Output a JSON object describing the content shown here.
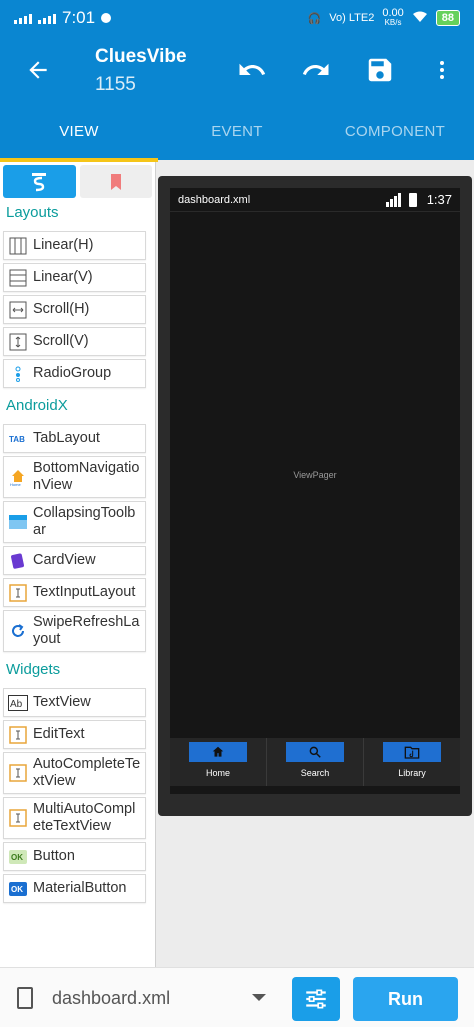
{
  "status_bar": {
    "time": "7:01",
    "network_label": "Vo) LTE2",
    "speed_value": "0.00",
    "speed_unit": "KB/s",
    "battery": "88"
  },
  "app_bar": {
    "title": "CluesVibe",
    "subtitle": "1155"
  },
  "tabs": [
    {
      "label": "VIEW",
      "active": true
    },
    {
      "label": "EVENT",
      "active": false
    },
    {
      "label": "COMPONENT",
      "active": false
    }
  ],
  "palette": {
    "sections": [
      {
        "title": "Layouts",
        "items": [
          {
            "label": "Linear(H)",
            "icon": "linear-horizontal-icon"
          },
          {
            "label": "Linear(V)",
            "icon": "linear-vertical-icon"
          },
          {
            "label": "Scroll(H)",
            "icon": "scroll-horizontal-icon"
          },
          {
            "label": "Scroll(V)",
            "icon": "scroll-vertical-icon"
          },
          {
            "label": "RadioGroup",
            "icon": "radiogroup-icon"
          }
        ]
      },
      {
        "title": "AndroidX",
        "items": [
          {
            "label": "TabLayout",
            "icon": "tablayout-icon"
          },
          {
            "label": "BottomNavigationView",
            "icon": "bottomnav-icon"
          },
          {
            "label": "CollapsingToolbar",
            "icon": "collapsing-toolbar-icon"
          },
          {
            "label": "CardView",
            "icon": "cardview-icon"
          },
          {
            "label": "TextInputLayout",
            "icon": "textinput-icon"
          },
          {
            "label": "SwipeRefreshLayout",
            "icon": "swiperefresh-icon"
          }
        ]
      },
      {
        "title": "Widgets",
        "items": [
          {
            "label": "TextView",
            "icon": "textview-icon"
          },
          {
            "label": "EditText",
            "icon": "edittext-icon"
          },
          {
            "label": "AutoCompleteTextView",
            "icon": "autocomplete-icon"
          },
          {
            "label": "MultiAutoCompleteTextView",
            "icon": "multiautocomplete-icon"
          },
          {
            "label": "Button",
            "icon": "button-icon"
          },
          {
            "label": "MaterialButton",
            "icon": "materialbutton-icon"
          }
        ]
      }
    ]
  },
  "preview": {
    "file": "dashboard.xml",
    "time": "1:37",
    "viewpager_label": "ViewPager",
    "nav": [
      {
        "label": "Home",
        "icon": "home-icon"
      },
      {
        "label": "Search",
        "icon": "search-icon"
      },
      {
        "label": "Library",
        "icon": "library-icon"
      }
    ]
  },
  "bottom_bar": {
    "file_name": "dashboard.xml",
    "run_label": "Run"
  },
  "colors": {
    "primary": "#0a86d1",
    "accent": "#f5c518",
    "section_title": "#0b9c9c",
    "run_button": "#2aa5ef"
  }
}
